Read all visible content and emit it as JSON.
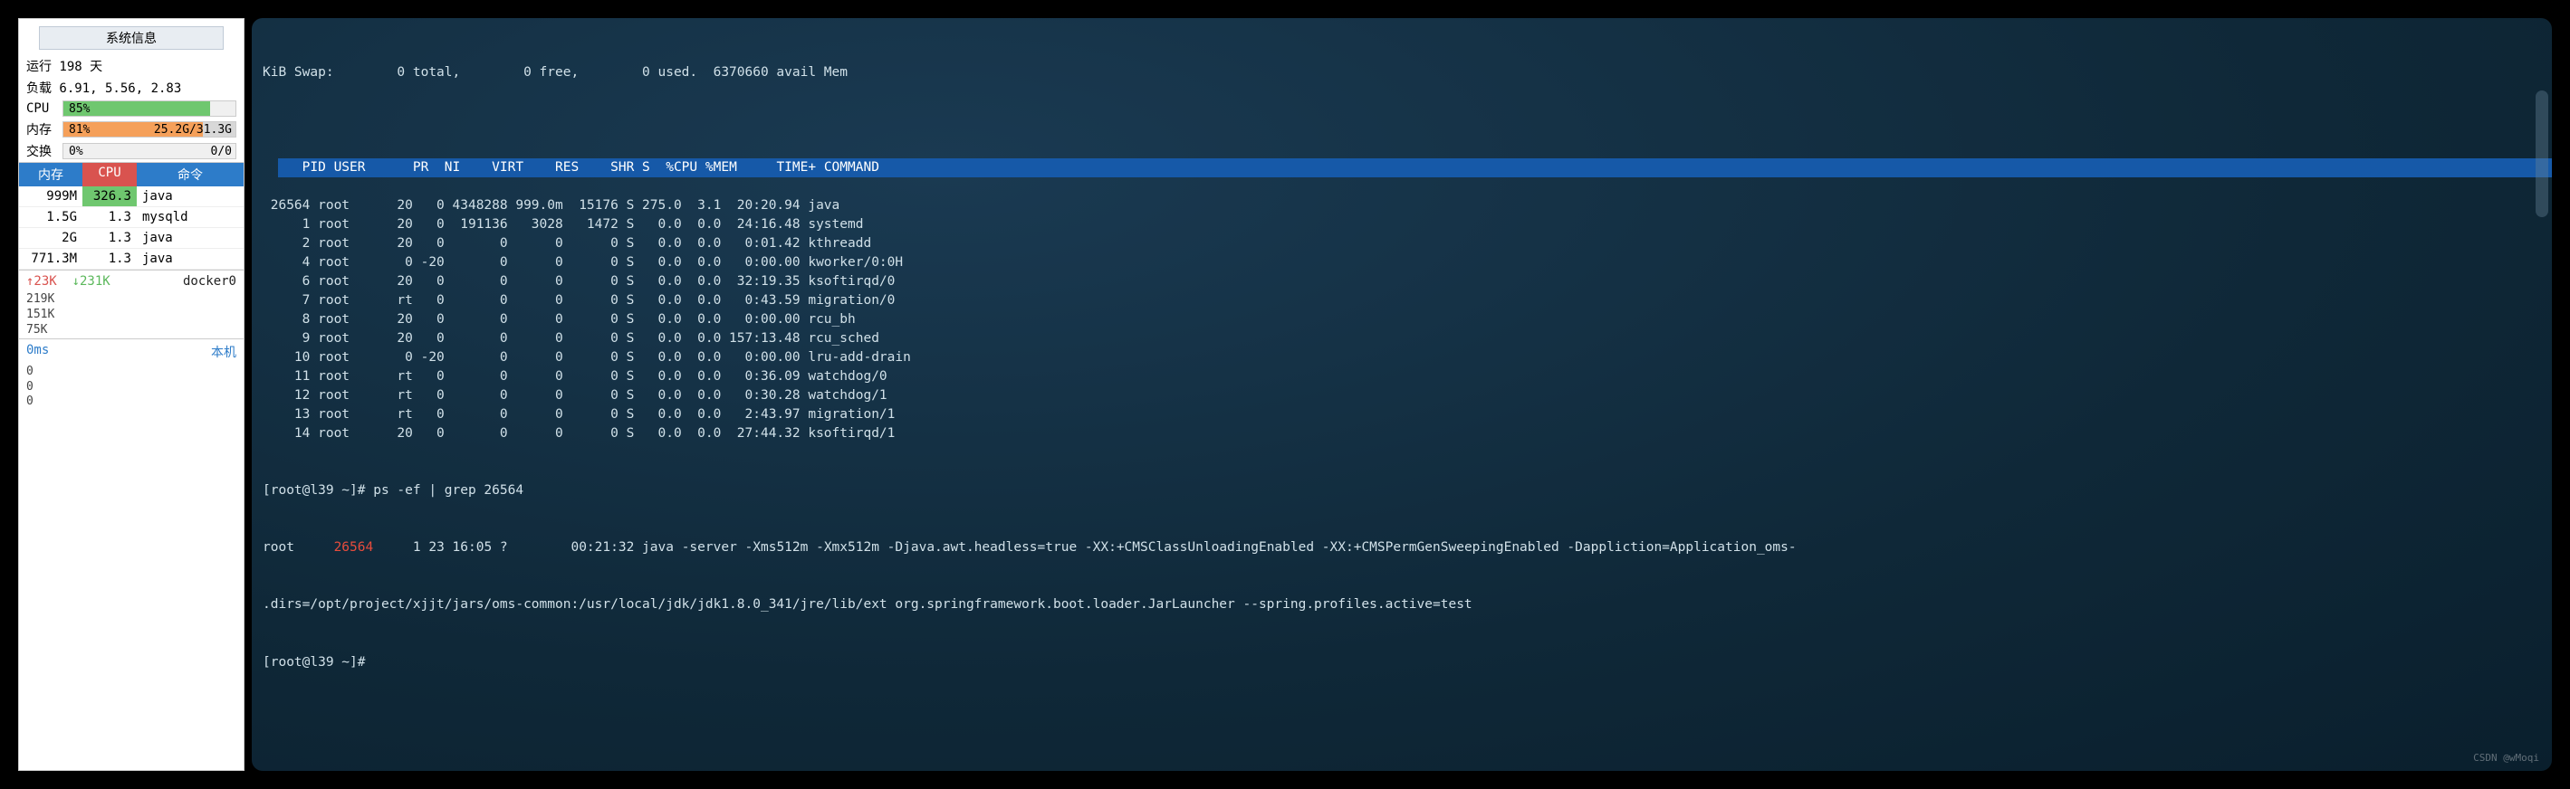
{
  "sidebar": {
    "header": "系统信息",
    "uptime": "运行 198 天",
    "load": "负载 6.91, 5.56, 2.83",
    "cpu": {
      "label": "CPU",
      "pct": "85%",
      "fill": 85
    },
    "mem": {
      "label": "内存",
      "pct": "81%",
      "detail": "25.2G/31.3G",
      "fill": 81
    },
    "swap": {
      "label": "交换",
      "pct": "0%",
      "detail": "0/0"
    },
    "proc_header": {
      "mem": "内存",
      "cpu": "CPU",
      "cmd": "命令"
    },
    "procs": [
      {
        "mem": "999M",
        "cpu": "326.3",
        "cmd": "java",
        "hl": true
      },
      {
        "mem": "1.5G",
        "cpu": "1.3",
        "cmd": "mysqld"
      },
      {
        "mem": "2G",
        "cpu": "1.3",
        "cmd": "java"
      },
      {
        "mem": "771.3M",
        "cpu": "1.3",
        "cmd": "java"
      }
    ],
    "net": {
      "up": "↑23K",
      "down": "↓231K",
      "iface": "docker0",
      "scale": [
        "219K",
        "151K",
        "75K"
      ]
    },
    "ping": {
      "ms": "0ms",
      "host": "本机",
      "scale": [
        "0",
        "0",
        "0"
      ]
    }
  },
  "terminal": {
    "swap_line": "KiB Swap:        0 total,        0 free,        0 used.  6370660 avail Mem",
    "header": "   PID USER      PR  NI    VIRT    RES    SHR S  %CPU %MEM     TIME+ COMMAND                                                                                                                                          ",
    "rows": [
      " 26564 root      20   0 4348288 999.0m  15176 S 275.0  3.1  20:20.94 java",
      "     1 root      20   0  191136   3028   1472 S   0.0  0.0  24:16.48 systemd",
      "     2 root      20   0       0      0      0 S   0.0  0.0   0:01.42 kthreadd",
      "     4 root       0 -20       0      0      0 S   0.0  0.0   0:00.00 kworker/0:0H",
      "     6 root      20   0       0      0      0 S   0.0  0.0  32:19.35 ksoftirqd/0",
      "     7 root      rt   0       0      0      0 S   0.0  0.0   0:43.59 migration/0",
      "     8 root      20   0       0      0      0 S   0.0  0.0   0:00.00 rcu_bh",
      "     9 root      20   0       0      0      0 S   0.0  0.0 157:13.48 rcu_sched",
      "    10 root       0 -20       0      0      0 S   0.0  0.0   0:00.00 lru-add-drain",
      "    11 root      rt   0       0      0      0 S   0.0  0.0   0:36.09 watchdog/0",
      "    12 root      rt   0       0      0      0 S   0.0  0.0   0:30.28 watchdog/1",
      "    13 root      rt   0       0      0      0 S   0.0  0.0   2:43.97 migration/1",
      "    14 root      20   0       0      0      0 S   0.0  0.0  27:44.32 ksoftirqd/1"
    ],
    "ps_prompt": "[root@l39 ~]# ps -ef | grep 26564",
    "ps_line1_a": "root     ",
    "ps_pid": "26564",
    "ps_line1_b": "     1 23 16:05 ?        00:21:32 java -server -Xms512m -Xmx512m -Djava.awt.headless=true -XX:+CMSClassUnloadingEnabled -XX:+CMSPermGenSweepingEnabled -Dappliction=Application_oms-",
    "ps_line2": ".dirs=/opt/project/xjjt/jars/oms-common:/usr/local/jdk/jdk1.8.0_341/jre/lib/ext org.springframework.boot.loader.JarLauncher --spring.profiles.active=test",
    "prompt2": "[root@l39 ~]# ",
    "watermark": "CSDN @wMoqi"
  }
}
